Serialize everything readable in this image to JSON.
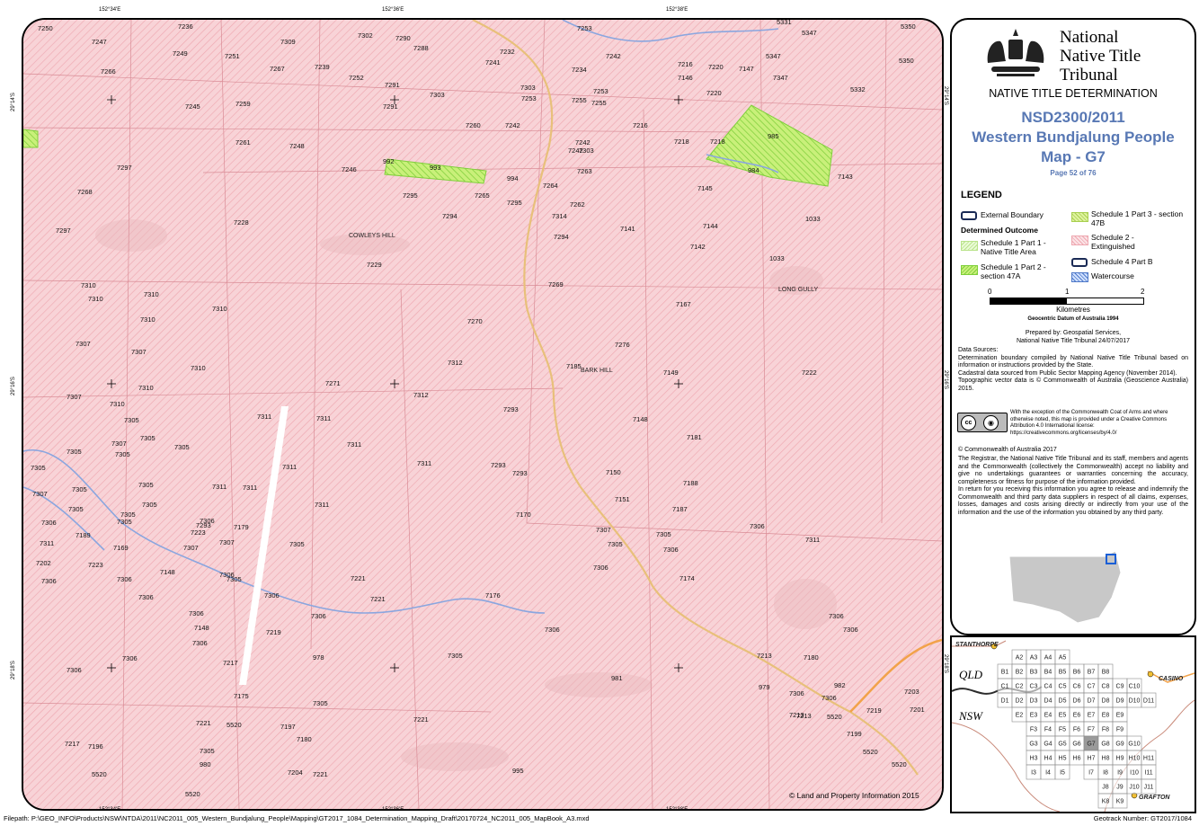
{
  "map": {
    "coords_top": [
      "152°34'E",
      "152°36'E",
      "152°38'E"
    ],
    "coords_bottom": [
      "152°34'E",
      "152°36'E",
      "152°38'E"
    ],
    "coords_left": [
      "29°14'S",
      "29°16'S",
      "29°18'S"
    ],
    "coords_right": [
      "29°14'S",
      "29°16'S",
      "29°18'S"
    ],
    "copyright": "© Land and Property Information 2015",
    "place_names": [
      "COWLEYS HILL",
      "LONG GULLY",
      "BARK HILL"
    ],
    "parcel_labels": [
      "7250",
      "7247",
      "7236",
      "7249",
      "7251",
      "7309",
      "7302",
      "7290",
      "7288",
      "7253",
      "7266",
      "7267",
      "7239",
      "7252",
      "7291",
      "7303",
      "7232",
      "7241",
      "7234",
      "7242",
      "7216",
      "7220",
      "7147",
      "5347",
      "5331",
      "5347",
      "5350",
      "5350",
      "7245",
      "7259",
      "7291",
      "7260",
      "7303",
      "7253",
      "7255",
      "7255",
      "7253",
      "7242",
      "7146",
      "7220",
      "7347",
      "5332",
      "7261",
      "7248",
      "7242",
      "7303",
      "7216",
      "7218",
      "985",
      "7297",
      "7246",
      "992",
      "993",
      "994",
      "7263",
      "7242",
      "7218",
      "984",
      "7143",
      "7268",
      "7295",
      "7265",
      "7264",
      "7295",
      "7262",
      "7145",
      "7297",
      "7228",
      "7294",
      "7314",
      "7141",
      "7144",
      "1033",
      "7294",
      "7142",
      "7229",
      "1033",
      "7310",
      "7310",
      "7310",
      "7269",
      "7167",
      "7310",
      "7310",
      "7270",
      "7307",
      "7307",
      "7310",
      "7312",
      "7276",
      "7185",
      "7149",
      "7222",
      "7310",
      "7271",
      "7312",
      "7307",
      "7310",
      "7293",
      "7148",
      "7305",
      "7305",
      "7311",
      "7311",
      "7311",
      "7181",
      "7307",
      "7305",
      "7305",
      "7305",
      "7311",
      "7293",
      "7293",
      "7150",
      "7305",
      "7311",
      "7188",
      "7305",
      "7305",
      "7311",
      "7311",
      "7151",
      "7307",
      "7305",
      "7311",
      "7187",
      "7305",
      "7306",
      "7293",
      "7170",
      "7305",
      "7305",
      "7306",
      "7223",
      "7179",
      "7307",
      "7305",
      "7306",
      "7311",
      "7202",
      "7189",
      "7169",
      "7307",
      "7307",
      "7305",
      "7305",
      "7306",
      "7311",
      "7223",
      "7148",
      "7305",
      "7306",
      "7306",
      "7306",
      "7221",
      "7174",
      "7306",
      "7306",
      "7306",
      "7306",
      "7221",
      "7176",
      "7148",
      "7219",
      "7306",
      "7306",
      "7306",
      "7217",
      "978",
      "7305",
      "7306",
      "7306",
      "7306",
      "7175",
      "7305",
      "7221",
      "7213",
      "7217",
      "981",
      "982",
      "7197",
      "979",
      "7180",
      "7306",
      "7306",
      "7306",
      "7213",
      "7219",
      "5520",
      "5520",
      "7213",
      "7203",
      "7305",
      "5520",
      "7221",
      "7180",
      "980",
      "7199",
      "5520",
      "7221",
      "7201",
      "5520",
      "5520",
      "7196",
      "7204",
      "995"
    ]
  },
  "panel": {
    "org_line1": "National",
    "org_line2": "Native Title",
    "org_line3": "Tribunal",
    "determination": "NATIVE TITLE DETERMINATION",
    "file_number": "NSD2300/2011",
    "claim_name": "Western Bundjalung People",
    "map_id": "Map - G7",
    "page": "Page 52 of 76",
    "legend_title": "LEGEND",
    "legend": {
      "external_boundary": "External Boundary",
      "determined_outcome": "Determined Outcome",
      "s1p1": "Schedule 1 Part 1 - Native Title Area",
      "s1p2": "Schedule 1 Part 2 - section 47A",
      "s1p3": "Schedule 1 Part 3 - section 47B",
      "s2": "Schedule 2 - Extinguished",
      "s4": "Schedule 4 Part B",
      "water": "Watercourse"
    },
    "scale": {
      "ticks": [
        "0",
        "1",
        "2"
      ],
      "unit": "Kilometres",
      "datum": "Geocentric Datum of Australia 1994"
    },
    "prepared_line1": "Prepared by: Geospatial Services,",
    "prepared_line2": "National Native Title Tribunal  24/07/2017",
    "data_sources": "Data Sources:",
    "ds_text1": "Determination boundary compiled by National Native Title Tribunal based on information or instructions provided by the State.",
    "ds_text2": "Cadastral data sourced from Public Sector Mapping Agency (November 2014).",
    "ds_text3": "Topographic vector data is © Commonwealth of Australia (Geoscience Australia) 2015.",
    "cc_text": "With the exception of the Commonwealth Coat of Arms and where otherwise noted, this map is provided under a Creative Commons Attribution 4.0 International license: https://creativecommons.org/licenses/by/4.0/",
    "commonwealth": "© Commonwealth of Australia 2017",
    "disclaimer1": "The Registrar, the National Native Title Tribunal and its staff, members and agents and the Commonwealth (collectively the Commonwealth) accept no liability and give no undertakings guarantees or warranties concerning the accuracy, completeness or fitness for purpose of the information provided.",
    "disclaimer2": "In return for you receiving this information you agree to release and indemnify the Commonwealth and third party data suppliers in respect of all claims, expenses, losses, damages and costs arising directly or indirectly from your use of the information and the use of the information you obtained by any third party."
  },
  "inset": {
    "places": [
      "STANTHORPE",
      "CASINO",
      "GRAFTON",
      "QLD",
      "NSW"
    ],
    "grid_rows": [
      [
        "A2",
        "A3",
        "A4",
        "A5"
      ],
      [
        "B1",
        "B2",
        "B3",
        "B4",
        "B5",
        "B6",
        "B7",
        "B8"
      ],
      [
        "C1",
        "C2",
        "C3",
        "C4",
        "C5",
        "C6",
        "C7",
        "C8",
        "C9",
        "C10"
      ],
      [
        "D1",
        "D2",
        "D3",
        "D4",
        "D5",
        "D6",
        "D7",
        "D8",
        "D9",
        "D10",
        "D11"
      ],
      [
        "E2",
        "E3",
        "E4",
        "E5",
        "E6",
        "E7",
        "E8",
        "E9"
      ],
      [
        "F3",
        "F4",
        "F5",
        "F6",
        "F7",
        "F8",
        "F9"
      ],
      [
        "G3",
        "G4",
        "G5",
        "G6",
        "G7",
        "G8",
        "G9",
        "G10"
      ],
      [
        "H3",
        "H4",
        "H5",
        "H6",
        "H7",
        "H8",
        "H9",
        "H10",
        "H11"
      ],
      [
        "I3",
        "I4",
        "I5",
        "I7",
        "I8",
        "I9",
        "I10",
        "I11"
      ],
      [
        "J8",
        "J9",
        "J10",
        "J11"
      ],
      [
        "K8",
        "K9"
      ]
    ],
    "highlight": "G7"
  },
  "footer": {
    "filepath": "Filepath: P:\\GEO_INFO\\Products\\NSW\\NTDA\\2011\\NC2011_005_Western_Bundjalung_People\\Mapping\\GT2017_1084_Determination_Mapping_Draft\\20170724_NC2011_005_MapBook_A3.mxd",
    "geotrack": "Geotrack Number: GT2017/1084"
  }
}
